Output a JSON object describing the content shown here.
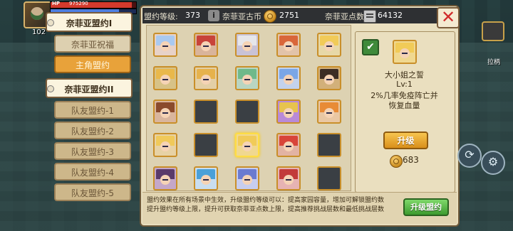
{
  "hud": {
    "hp_label": "HP",
    "hp_value": "975290",
    "hp_fraction": 0.95,
    "mp_fraction": 0.8,
    "level": "102",
    "right_label": "拉柄"
  },
  "panel": {
    "topbar": {
      "alliance_level_label": "盟约等级:",
      "alliance_level_value": "373",
      "coin_label": "奈菲亚古币",
      "coin_value": "2751",
      "points_label": "奈菲亚点数",
      "points_value": "64132"
    },
    "close_symbol": "✕"
  },
  "tabs": [
    {
      "label": "奈菲亚盟约I",
      "style": "header"
    },
    {
      "label": "奈菲亚祝福",
      "style": "plain"
    },
    {
      "label": "主角盟约",
      "style": "active"
    },
    {
      "label": "奈菲亚盟约II",
      "style": "header"
    },
    {
      "label": "队友盟约-1",
      "style": "plain"
    },
    {
      "label": "队友盟约-2",
      "style": "plain"
    },
    {
      "label": "队友盟约-3",
      "style": "plain"
    },
    {
      "label": "队友盟约-4",
      "style": "plain"
    },
    {
      "label": "队友盟约-5",
      "style": "plain"
    }
  ],
  "grid": {
    "rows": [
      [
        {
          "state": "filled",
          "hair": "#a9c9f0",
          "bg": "#e7d2c8"
        },
        {
          "state": "filled",
          "hair": "#c8433a",
          "bg": "#d9b49b"
        },
        {
          "state": "filled",
          "hair": "#e6e6ea",
          "bg": "#c9c2d6"
        },
        {
          "state": "filled",
          "hair": "#d9663a",
          "bg": "#e2c3a9"
        },
        {
          "state": "filled",
          "hair": "#f1cb58",
          "bg": "#e7d8a7"
        }
      ],
      [
        {
          "state": "filled",
          "hair": "#e9b84b",
          "bg": "#d7c287"
        },
        {
          "state": "filled",
          "hair": "#e6b24c",
          "bg": "#e3cfa6"
        },
        {
          "state": "filled",
          "hair": "#6fb98a",
          "bg": "#b9d5c2"
        },
        {
          "state": "filled",
          "hair": "#7aa6e6",
          "bg": "#c3d2ec"
        },
        {
          "state": "filled",
          "hair": "#3c2d24",
          "bg": "#d2b07a"
        }
      ],
      [
        {
          "state": "filled",
          "hair": "#8a4a2c",
          "bg": "#d9b59d"
        },
        {
          "state": "empty"
        },
        {
          "state": "empty"
        },
        {
          "state": "filled",
          "hair": "#e7c34e",
          "bg": "#b98ad7"
        },
        {
          "state": "filled",
          "hair": "#e88b36",
          "bg": "#e9c7a3"
        }
      ],
      [
        {
          "state": "filled",
          "hair": "#f0c95a",
          "bg": "#e7d2a5"
        },
        {
          "state": "empty"
        },
        {
          "state": "selected",
          "hair": "#f1cb58",
          "bg": "#f0d890"
        },
        {
          "state": "filled",
          "hair": "#d8453a",
          "bg": "#e2b3a3"
        },
        {
          "state": "empty"
        }
      ],
      [
        {
          "state": "filled",
          "hair": "#5a3a6a",
          "bg": "#c4a7c9"
        },
        {
          "state": "filled",
          "hair": "#4aa0d8",
          "bg": "#c9def0"
        },
        {
          "state": "filled",
          "hair": "#6b7bd0",
          "bg": "#c7cdee"
        },
        {
          "state": "filled",
          "hair": "#c23a3a",
          "bg": "#e6b3b3"
        },
        {
          "state": "empty"
        }
      ]
    ]
  },
  "detail": {
    "name": "大小姐之誓",
    "level": "Lv:1",
    "desc_line1": "2%几率免疫阵亡并",
    "desc_line2": "恢复血量",
    "upgrade_label": "升级",
    "cost": "683",
    "checkbox": "✔"
  },
  "bottom": {
    "line1": "盟约效果在所有场景中生效，升级盟约等级可以：提高家园容量，增加可解锁盟约数",
    "line2": "提升盟约等级上限，提升可获取奈菲亚点数上限，提高推荐挑战层数和最低挑战层数",
    "button": "升级盟约"
  },
  "controls": {
    "refresh_icon": "⟳",
    "gear_icon": "⚙"
  }
}
